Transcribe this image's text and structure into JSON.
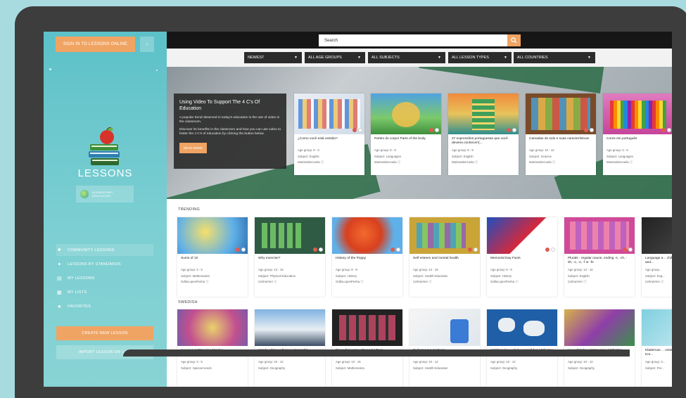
{
  "sidebar": {
    "signin_label": "SIGN IN TO LESSONS ONLINE",
    "menu_glyph": "›",
    "title": "LESSONS",
    "badge": {
      "line1": "ELEMENTARY",
      "line2": "EDUCATION"
    },
    "nav": [
      {
        "label": "COMMUNITY LESSONS",
        "icon": "community-icon",
        "glyph": "♣"
      },
      {
        "label": "LESSONS BY STANDARDS",
        "icon": "lightbulb-icon",
        "glyph": "💡"
      },
      {
        "label": "MY LESSONS",
        "icon": "document-icon",
        "glyph": "▤"
      },
      {
        "label": "MY LISTS",
        "icon": "list-icon",
        "glyph": "▦"
      },
      {
        "label": "FAVORITES",
        "icon": "star-icon",
        "glyph": "★"
      }
    ],
    "create_label": "CREATE NEW LESSON",
    "import_label": "IMPORT LESSON OR LIST"
  },
  "search": {
    "placeholder": "Search",
    "icon": "search-icon"
  },
  "filters": [
    {
      "label": "NEWEST"
    },
    {
      "label": "ALL AGE GROUPS"
    },
    {
      "label": "ALL SUBJECTS"
    },
    {
      "label": "ALL LESSON TYPES"
    },
    {
      "label": "ALL COUNTRIES"
    }
  ],
  "hero": {
    "title": "Using Video To Support The 4 C's Of Education",
    "desc1": "A popular trend observed in today's education is the use of video in the classroom.",
    "desc2": "Discover its benefits in the classroom and how you can use video to foster the 4 C's of education by clicking the button below.",
    "read_more": "READ MORE",
    "cards": [
      {
        "title": "¿Como você está vestido?",
        "age": "Age group: 8 - 9",
        "subject": "Subject: English",
        "author": "MariaValenzuela ⓘ"
      },
      {
        "title": "Partes do corpo/ Parts of the body",
        "age": "Age group: 8 - 9",
        "subject": "Subject: Languages",
        "author": "MariaValenzuela ⓘ"
      },
      {
        "title": "27 expressões portuguesas que você deveria conhecer!(...",
        "age": "Age group: 8 - 9",
        "subject": "Subject: English",
        "author": "MariaValenzuela ⓘ"
      },
      {
        "title": "Camadas do solo e suas características",
        "age": "Age group: 10 - 12",
        "subject": "Subject: Science",
        "author": "MariaValenzuela ⓘ"
      },
      {
        "title": "Cores em português",
        "age": "Age group: 3 - 5",
        "subject": "Subject: Languages",
        "author": "MariaValenzuela ⓘ"
      }
    ]
  },
  "trending": {
    "label": "TRENDING",
    "cards": [
      {
        "title": "Sums of 10",
        "age": "Age group: 3 - 5",
        "subject": "Subject: Mathematics",
        "author": "OdileLopesPenha ⓘ"
      },
      {
        "title": "Why exercise?",
        "age": "Age group: 13 - 15",
        "subject": "Subject: Physical Education",
        "author": "CelinaVrier ⓘ"
      },
      {
        "title": "History of the Poppy",
        "age": "Age group: 8 - 9",
        "subject": "Subject: History",
        "author": "OdileLopesPenha ⓘ"
      },
      {
        "title": "Self esteem and mental health",
        "age": "Age group: 13 - 15",
        "subject": "Subject: Health Education",
        "author": "CelinaVrier ⓘ"
      },
      {
        "title": "Memorial Day Facts",
        "age": "Age group: 8 - 9",
        "subject": "Subject: History",
        "author": "OdileLopesPenha ⓘ"
      },
      {
        "title": "Plurals - regular nouns, ending -s, -ch, -sh, -x, -o, -f or -fe",
        "age": "Age group: 13 - 15",
        "subject": "Subject: English",
        "author": "CelinaVrier ⓘ"
      },
      {
        "title": "Language a... children and...",
        "age": "Age group...",
        "subject": "Subject: Eng...",
        "author": "CelinaVrier ⓘ"
      }
    ]
  },
  "swedish": {
    "label": "SWEDISH",
    "cards": [
      {
        "title": "Hur man tvättar sina händer",
        "age": "Age group: 3 - 5",
        "subject": "Subject: Special needs"
      },
      {
        "title": "Kända aktiva vulkaner | Scramble",
        "age": "Age group: 10 - 12",
        "subject": "Subject: Geography"
      },
      {
        "title": "Procedimientos | Procent | Tags",
        "age": "Age group: 13 - 15",
        "subject": "Subject: Mathematics"
      },
      {
        "title": "Diabetes typ 2 | Bugs",
        "age": "Age group: 10 - 12",
        "subject": "Subject: Health Education"
      },
      {
        "title": "Världens hav och havsområden | Etiketter",
        "age": "Age group: 10 - 12",
        "subject": "Subject: Geography"
      },
      {
        "title": "Huvudstäder i Västeuropa | Etiketter",
        "age": "Age group: 10 - 12",
        "subject": "Subject: Geography"
      },
      {
        "title": "Klädernas ... vinter? | Kor...",
        "age": "Age group: 3...",
        "subject": "Subject: Per..."
      }
    ]
  },
  "colors": {
    "accent": "#f0a463",
    "sidebar": "#5cc1c8",
    "topbar": "#161616"
  }
}
